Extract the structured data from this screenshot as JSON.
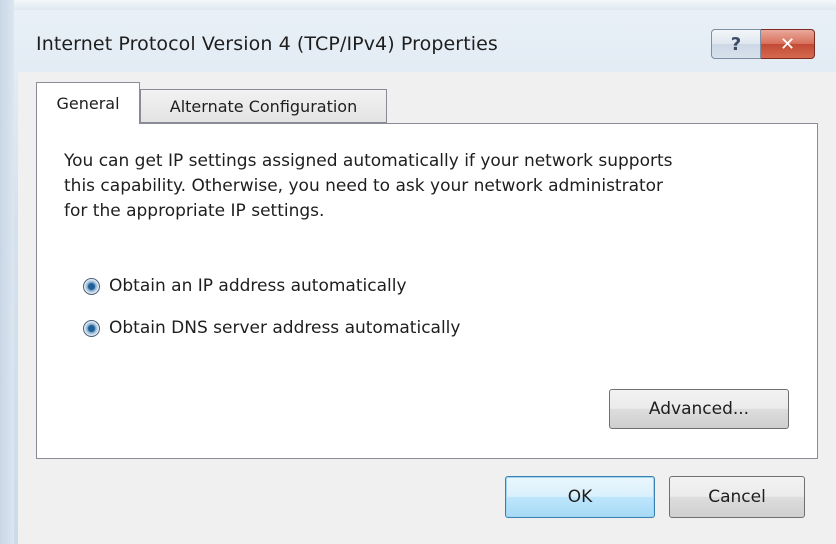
{
  "window": {
    "title": "Internet Protocol Version 4 (TCP/IPv4) Properties",
    "help_label": "?",
    "close_label": "✕"
  },
  "tabs": [
    {
      "label": "General",
      "selected": true
    },
    {
      "label": "Alternate Configuration",
      "selected": false
    }
  ],
  "general": {
    "description_lines": [
      "You can get IP settings assigned automatically if your network supports",
      "this capability. Otherwise, you need to ask your network administrator",
      "for the appropriate IP settings."
    ],
    "options": [
      {
        "label": "Obtain an IP address automatically",
        "checked": true
      },
      {
        "label": "Obtain DNS server address automatically",
        "checked": true
      }
    ],
    "advanced_label": "Advanced..."
  },
  "footer": {
    "ok_label": "OK",
    "cancel_label": "Cancel"
  }
}
